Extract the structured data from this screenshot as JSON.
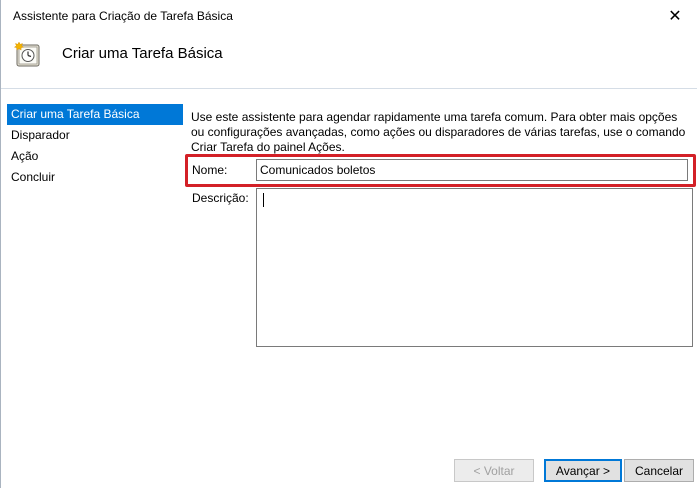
{
  "window": {
    "title": "Assistente para Criação de Tarefa Básica",
    "close_glyph": "✕"
  },
  "header": {
    "title": "Criar uma Tarefa Básica",
    "icon": "scheduled-task-clock-icon"
  },
  "nav": {
    "items": [
      {
        "label": "Criar uma Tarefa Básica",
        "active": true
      },
      {
        "label": "Disparador",
        "active": false
      },
      {
        "label": "Ação",
        "active": false
      },
      {
        "label": "Concluir",
        "active": false
      }
    ]
  },
  "content": {
    "intro": "Use este assistente para agendar rapidamente uma tarefa comum. Para obter mais opções ou configurações avançadas, como ações ou disparadores de várias tarefas, use o comando Criar Tarefa do painel Ações.",
    "name_label": "Nome:",
    "name_value": "Comunicados boletos",
    "description_label": "Descrição:",
    "description_value": ""
  },
  "buttons": {
    "back": "< Voltar",
    "next": "Avançar >",
    "cancel": "Cancelar"
  },
  "colors": {
    "accent": "#0078d7",
    "highlight": "#d32027"
  }
}
